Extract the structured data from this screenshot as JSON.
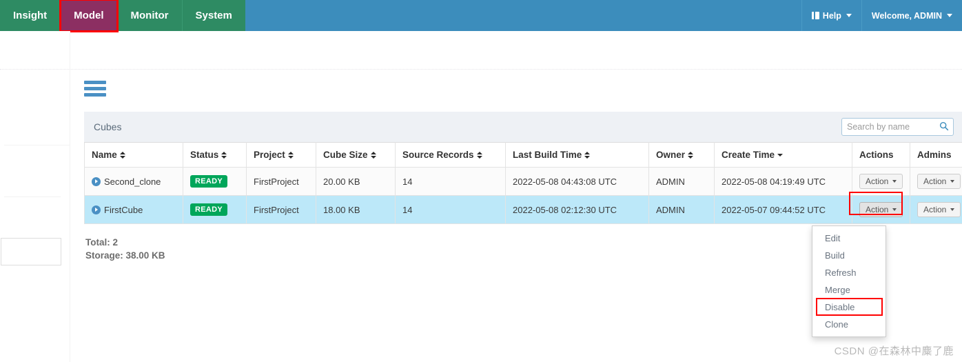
{
  "nav": {
    "tabs": [
      {
        "label": "Insight",
        "active": false
      },
      {
        "label": "Model",
        "active": true
      },
      {
        "label": "Monitor",
        "active": false
      },
      {
        "label": "System",
        "active": false
      }
    ],
    "help_label": "Help",
    "user_label": "Welcome, ADMIN"
  },
  "panel": {
    "title": "Cubes",
    "search_placeholder": "Search by name",
    "search_value": ""
  },
  "table": {
    "columns": [
      {
        "label": "Name",
        "sort": "both"
      },
      {
        "label": "Status",
        "sort": "both"
      },
      {
        "label": "Project",
        "sort": "both"
      },
      {
        "label": "Cube Size",
        "sort": "both"
      },
      {
        "label": "Source Records",
        "sort": "both"
      },
      {
        "label": "Last Build Time",
        "sort": "both"
      },
      {
        "label": "Owner",
        "sort": "both"
      },
      {
        "label": "Create Time",
        "sort": "desc"
      },
      {
        "label": "Actions",
        "sort": "none"
      },
      {
        "label": "Admins",
        "sort": "none"
      }
    ],
    "rows": [
      {
        "name": "Second_clone",
        "status": "READY",
        "project": "FirstProject",
        "cube_size": "20.00 KB",
        "source_records": "14",
        "last_build_time": "2022-05-08 04:43:08 UTC",
        "owner": "ADMIN",
        "create_time": "2022-05-08 04:19:49 UTC",
        "action_label": "Action",
        "admin_label": "Action"
      },
      {
        "name": "FirstCube",
        "status": "READY",
        "project": "FirstProject",
        "cube_size": "18.00 KB",
        "source_records": "14",
        "last_build_time": "2022-05-08 02:12:30 UTC",
        "owner": "ADMIN",
        "create_time": "2022-05-07 09:44:52 UTC",
        "action_label": "Action",
        "admin_label": "Action"
      }
    ]
  },
  "dropdown": {
    "items": [
      {
        "label": "Edit",
        "marked": false
      },
      {
        "label": "Build",
        "marked": false
      },
      {
        "label": "Refresh",
        "marked": false
      },
      {
        "label": "Merge",
        "marked": false
      },
      {
        "label": "Disable",
        "marked": true
      },
      {
        "label": "Clone",
        "marked": false
      }
    ]
  },
  "summary": {
    "total": "Total: 2",
    "storage": "Storage: 38.00 KB"
  },
  "watermark": "CSDN @在森林中麋了鹿",
  "colors": {
    "nav_green": "#2e8b63",
    "nav_active_purple": "#8c2f62",
    "header_blue": "#3c8dbc",
    "badge_green": "#00a65a",
    "row_highlight": "#bce8f9",
    "highlight_red": "#ff0000"
  }
}
